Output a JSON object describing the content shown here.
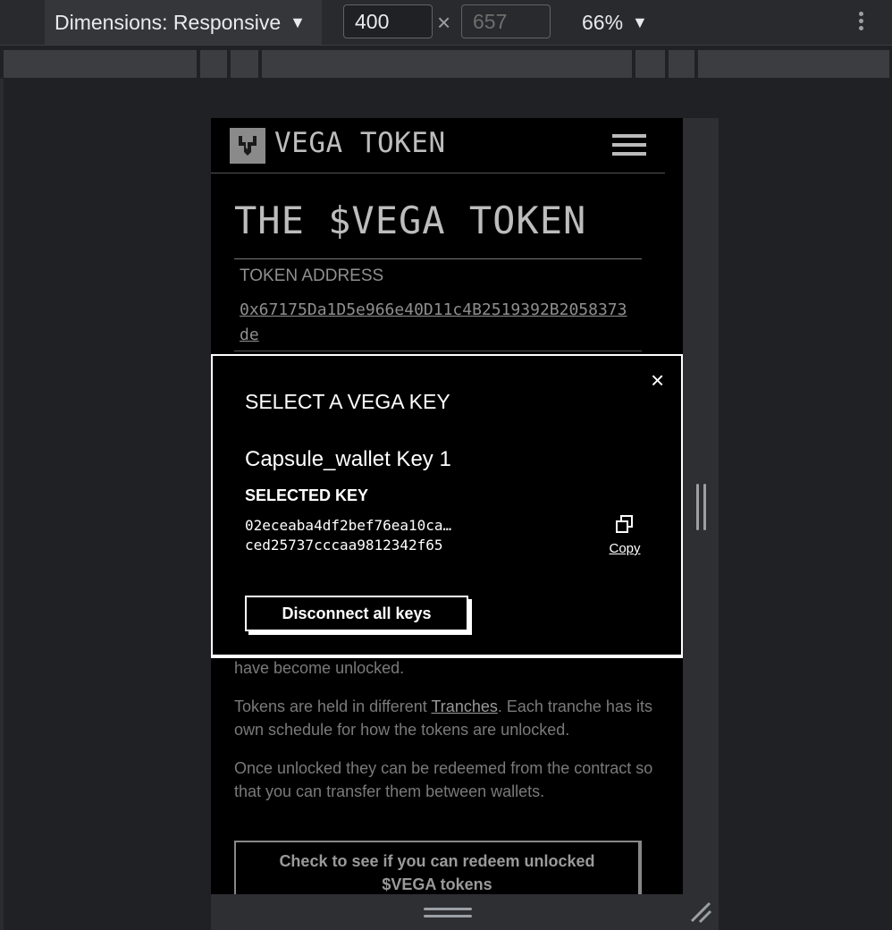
{
  "devtools": {
    "dimensions_label": "Dimensions: Responsive",
    "width_value": "400",
    "height_placeholder": "657",
    "times_symbol": "×",
    "zoom_label": "66%",
    "caret": "▼"
  },
  "site": {
    "name": "VEGA TOKEN",
    "page_title": "THE $VEGA TOKEN",
    "token_address_label": "TOKEN ADDRESS",
    "token_address": "0x67175Da1D5e966e40D11c4B2519392B2058373de",
    "paragraph_1_tail": "have become unlocked.",
    "paragraph_2_prefix": "Tokens are held in different ",
    "paragraph_2_link": "Tranches",
    "paragraph_2_suffix": ". Each tranche has its own schedule for how the tokens are unlocked.",
    "paragraph_3": "Once unlocked they can be redeemed from the contract so that you can transfer them between wallets.",
    "redeem_button_line1": "Check to see if you can redeem unlocked",
    "redeem_button_line2": "$VEGA tokens"
  },
  "modal": {
    "close_symbol": "×",
    "title": "SELECT A VEGA KEY",
    "key_name": "Capsule_wallet Key 1",
    "selected_key_label": "SELECTED KEY",
    "key_line_1": "02eceaba4df2bef76ea10ca…",
    "key_line_2": "ced25737cccaa9812342f65",
    "copy_label": "Copy",
    "disconnect_label": "Disconnect all keys"
  }
}
